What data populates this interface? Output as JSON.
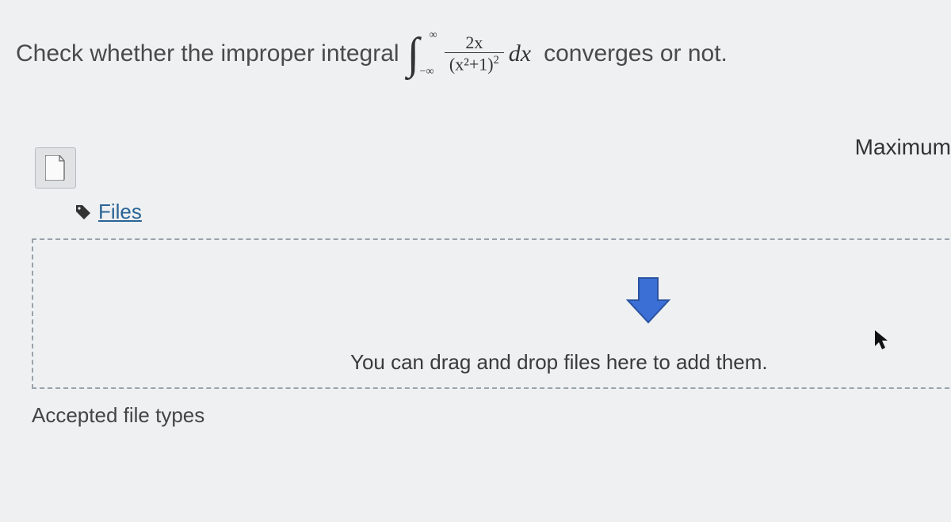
{
  "question": {
    "prefix": "Check whether the improper integral",
    "integral": {
      "upper": "∞",
      "lower": "−∞",
      "numerator": "2x",
      "denominator_inner": "x²+1",
      "denominator_exp": "2",
      "dx": "dx"
    },
    "suffix": "converges or not."
  },
  "maximum_label": "Maximum",
  "files": {
    "link_label": "Files"
  },
  "dropzone": {
    "hint": "You can drag and drop files here to add them."
  },
  "accepted_label": "Accepted file types"
}
